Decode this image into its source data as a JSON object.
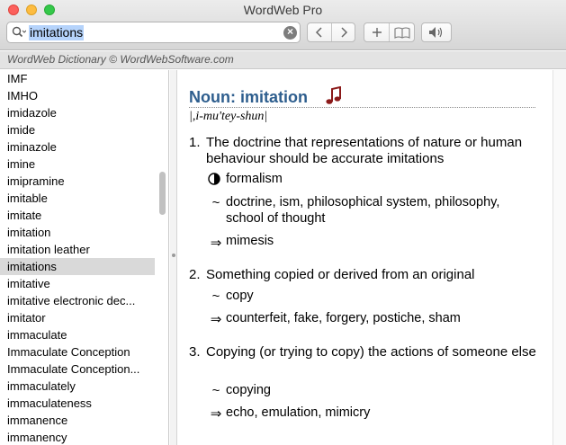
{
  "window": {
    "title": "WordWeb Pro"
  },
  "search": {
    "value": "imitations"
  },
  "banner": {
    "text": "WordWeb Dictionary © WordWebSoftware.com"
  },
  "wordlist": {
    "items": [
      "IMF",
      "IMHO",
      "imidazole",
      "imide",
      "iminazole",
      "imine",
      "imipramine",
      "imitable",
      "imitate",
      "imitation",
      "imitation leather",
      "imitations",
      "imitative",
      "imitative electronic dec...",
      "imitator",
      "immaculate",
      "Immaculate Conception",
      "Immaculate Conception...",
      "immaculately",
      "immaculateness",
      "immanence",
      "immanency"
    ],
    "selected_index": 11
  },
  "definition": {
    "heading": "Noun: imitation",
    "pronunciation": "|,i-mu'tey-shun|",
    "senses": [
      {
        "number": "1.",
        "text": "The doctrine that representations of nature or human behaviour should be accurate imitations",
        "relations": [
          {
            "symbol": "yin-yang-icon",
            "text": "formalism"
          },
          {
            "symbol": "~",
            "text": "doctrine, ism, philosophical system, philosophy, school of thought"
          },
          {
            "symbol": "⇒",
            "text": "mimesis"
          }
        ]
      },
      {
        "number": "2.",
        "text": "Something copied or derived from an original",
        "relations": [
          {
            "symbol": "~",
            "text": "copy"
          },
          {
            "symbol": "⇒",
            "text": "counterfeit, fake, forgery, postiche, sham"
          }
        ]
      },
      {
        "number": "3.",
        "text": "Copying (or trying to copy) the actions of someone else",
        "relations": [
          {
            "symbol": "~",
            "text": "copying"
          },
          {
            "symbol": "⇒",
            "text": "echo, emulation, mimicry"
          }
        ]
      }
    ]
  },
  "colors": {
    "heading": "#2e5e8e",
    "note_icon": "#8b1a1a",
    "selection": "#d9d9d9"
  }
}
